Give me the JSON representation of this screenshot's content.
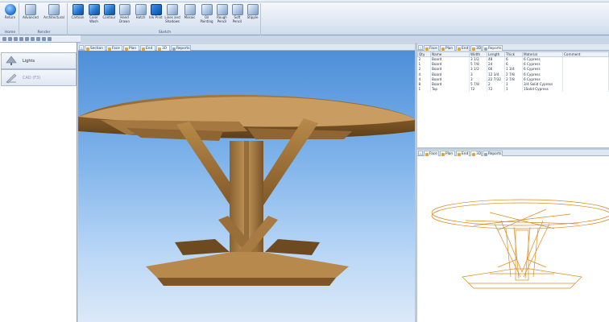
{
  "ribbon": {
    "groups": [
      {
        "label": "Home",
        "buttons": [
          {
            "label": "Return",
            "icon": "return-icon"
          }
        ]
      },
      {
        "label": "Render",
        "buttons": [
          {
            "label": "Advanced",
            "icon": "render-advanced-icon"
          },
          {
            "label": "Architectural",
            "icon": "render-architectural-icon"
          }
        ]
      },
      {
        "label": "Sketch",
        "buttons": [
          {
            "label": "Cartoon",
            "icon": "cartoon-icon"
          },
          {
            "label": "Color Wash",
            "icon": "color-wash-icon"
          },
          {
            "label": "Contour",
            "icon": "contour-icon"
          },
          {
            "label": "Hand Drawn",
            "icon": "hand-drawn-icon"
          },
          {
            "label": "Hatch",
            "icon": "hatch-icon"
          },
          {
            "label": "Ink Print",
            "icon": "ink-print-icon"
          },
          {
            "label": "Lines and Shadows",
            "icon": "lines-shadows-icon"
          },
          {
            "label": "Mosaic",
            "icon": "mosaic-icon"
          },
          {
            "label": "Oil Painting",
            "icon": "oil-painting-icon"
          },
          {
            "label": "Rough Pencil",
            "icon": "rough-pencil-icon"
          },
          {
            "label": "Soft Pencil",
            "icon": "soft-pencil-icon"
          },
          {
            "label": "Stipple",
            "icon": "stipple-icon"
          }
        ]
      }
    ]
  },
  "left_panel": {
    "items": [
      {
        "label": "Lights",
        "icon": "light-icon"
      },
      {
        "label": "CAD (F3)",
        "icon": "cad-icon"
      }
    ]
  },
  "main_tabs": [
    "Section",
    "Face",
    "Plan",
    "End",
    "3D",
    "Reports"
  ],
  "reports_tabs": [
    "Face",
    "Plan",
    "End",
    "3D",
    "Reports"
  ],
  "wire_tabs": [
    "Face",
    "Plan",
    "End",
    "3D",
    "Reports"
  ],
  "reports": {
    "columns": [
      "Qty",
      "Name",
      "Width",
      "Length",
      "Thick",
      "Material",
      "Comment"
    ],
    "rows": [
      [
        "2",
        "Board",
        "3 1/2",
        "48",
        "6",
        "6 Cypress",
        ""
      ],
      [
        "1",
        "Board",
        "5 7/8",
        "24",
        "6",
        "6 Cypress",
        ""
      ],
      [
        "2",
        "Board",
        "3 1/2",
        "66",
        "1 3/4",
        "6 Cypress",
        ""
      ],
      [
        "4",
        "Board",
        "3",
        "12 3/4",
        "2 7/8",
        "6 Cypress",
        ""
      ],
      [
        "4",
        "Board",
        "3",
        "22 7/32",
        "2 7/8",
        "6 Cypress",
        ""
      ],
      [
        "8",
        "Board",
        "5 7/8",
        "2",
        "1",
        "3/4 Solid Cypress",
        ""
      ],
      [
        "1",
        "Top",
        "72",
        "72",
        "1",
        "1Solid Cypress",
        ""
      ]
    ]
  },
  "colors": {
    "wood_light": "#b88a4a",
    "wood_dark": "#6e4a20",
    "wireframe": "#d98a1c",
    "viewport_sky": "#7fb3ea"
  }
}
